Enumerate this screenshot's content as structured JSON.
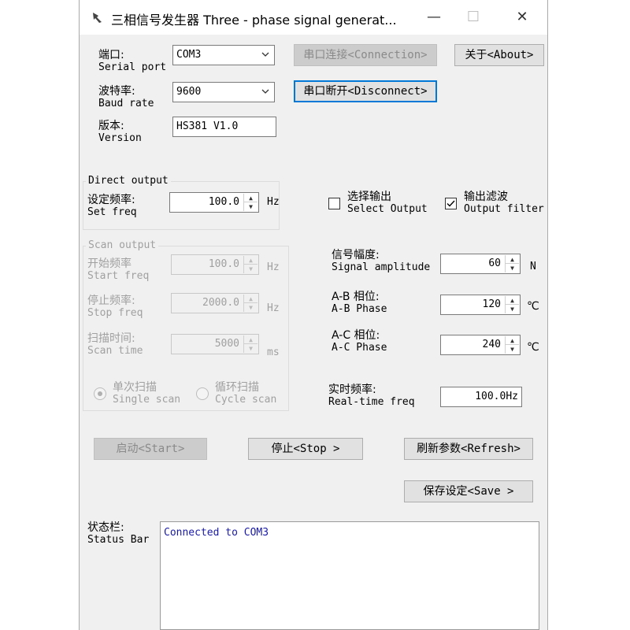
{
  "window": {
    "title": "三相信号发生器 Three - phase signal generat...",
    "controls": {
      "minimize": "—",
      "maximize": "☐",
      "close": "✕"
    }
  },
  "port": {
    "label_cn": "端口:",
    "label_en": "Serial port",
    "value": "COM3"
  },
  "baud": {
    "label_cn": "波特率:",
    "label_en": "Baud rate",
    "value": "9600"
  },
  "version": {
    "label_cn": "版本:",
    "label_en": "Version",
    "value": "HS381 V1.0"
  },
  "buttons": {
    "connect": "串口连接<Connection>",
    "disconnect": "串口断开<Disconnect>",
    "about": "关于<About>",
    "start": "启动<Start>",
    "stop": "停止<Stop >",
    "refresh": "刷新参数<Refresh>",
    "save": "保存设定<Save >"
  },
  "direct_output": {
    "title": "Direct output",
    "set_freq": {
      "label_cn": "设定频率:",
      "label_en": "Set freq",
      "value": "100.0",
      "unit": "Hz"
    }
  },
  "scan_output": {
    "title": "Scan output",
    "start_freq": {
      "label_cn": "开始频率",
      "label_en": "Start freq",
      "value": "100.0",
      "unit": "Hz"
    },
    "stop_freq": {
      "label_cn": "停止频率:",
      "label_en": "Stop freq",
      "value": "2000.0",
      "unit": "Hz"
    },
    "scan_time": {
      "label_cn": "扫描时间:",
      "label_en": "Scan time",
      "value": "5000",
      "unit": "ms"
    },
    "single_scan": {
      "label_cn": "单次扫描",
      "label_en": "Single scan",
      "checked": true
    },
    "cycle_scan": {
      "label_cn": "循环扫描",
      "label_en": "Cycle scan",
      "checked": false
    }
  },
  "options": {
    "select_output": {
      "label_cn": "选择输出",
      "label_en": "Select Output",
      "checked": false
    },
    "output_filter": {
      "label_cn": "输出滤波",
      "label_en": "Output filter",
      "checked": true
    }
  },
  "signal": {
    "amplitude": {
      "label_cn": "信号幅度:",
      "label_en": "Signal amplitude",
      "value": "60",
      "unit": "N"
    },
    "ab_phase": {
      "label_cn": "A-B 相位:",
      "label_en": "A-B Phase",
      "value": "120",
      "unit": "℃"
    },
    "ac_phase": {
      "label_cn": "A-C 相位:",
      "label_en": "A-C Phase",
      "value": "240",
      "unit": "℃"
    },
    "realtime": {
      "label_cn": "实时频率:",
      "label_en": "Real-time freq",
      "value": "100.0Hz"
    }
  },
  "status": {
    "label_cn": "状态栏:",
    "label_en": "Status Bar",
    "text": "Connected to COM3"
  },
  "colors": {
    "accent": "#0078d7",
    "status_text": "#1a1aa6",
    "window_bg": "#f0f0f0"
  }
}
